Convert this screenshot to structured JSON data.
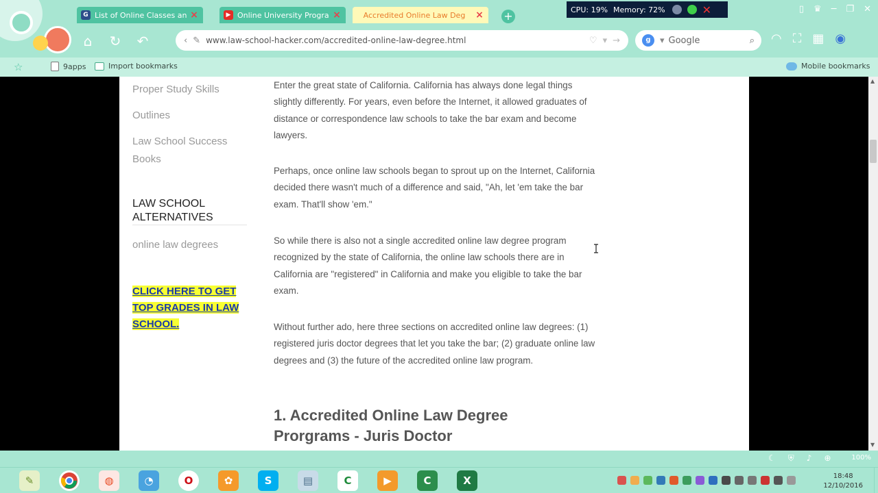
{
  "browser": {
    "tabs": [
      {
        "title": "List of Online Classes and I",
        "favicon": "G",
        "favicon_color": "#2c4e8a"
      },
      {
        "title": "Online University Programs",
        "favicon": "▶",
        "favicon_color": "#e52d27"
      },
      {
        "title": "Accredited Online Law Deg",
        "active": true
      }
    ],
    "system_monitor": {
      "cpu": "CPU: 19%",
      "memory": "Memory: 72%"
    },
    "url": "www.law-school-hacker.com/accredited-online-law-degree.html",
    "search_placeholder": "Google",
    "bookmarks": {
      "item1": "9apps",
      "item2": "Import bookmarks",
      "mobile": "Mobile bookmarks"
    },
    "zoom": "100%"
  },
  "sidebar": {
    "links": [
      "Proper Study Skills",
      "Outlines",
      "Law School Success Books"
    ],
    "alternatives_heading": "LAW SCHOOL ALTERNATIVES",
    "alternatives_link": "online law degrees",
    "cta": "CLICK HERE TO GET TOP GRADES IN LAW SCHOOL."
  },
  "article": {
    "paragraphs": [
      "Enter the great state of California. California has always done legal things slightly differently. For years, even before the Internet, it allowed graduates of distance or correspondence law schools to take the bar exam and become lawyers.",
      "Perhaps, once online law schools began to sprout up on the Internet, California decided there wasn't much of a difference and said, \"Ah, let 'em take the bar exam. That'll show 'em.\"",
      "So while there is also not a single accredited online law degree program recognized by the state of California, the online law schools there are in California are \"registered\" in California and make you eligible to take the bar exam.",
      "Without further ado, here three sections on accredited online law degrees: (1) registered juris doctor degrees that let you take the bar; (2) graduate online law degrees and (3) the future of the accredited online law program."
    ],
    "heading": "1. Accredited Online Law Degree Prorgrams - Juris Doctor"
  },
  "taskbar": {
    "time": "18:48",
    "date": "12/10/2016"
  },
  "colors": {
    "chrome": "#a8e6d2",
    "tab": "#4fc3a1",
    "active_tab": "#fff9b8",
    "cta_highlight": "#f7ff33",
    "cta_text": "#1a3aa8"
  }
}
